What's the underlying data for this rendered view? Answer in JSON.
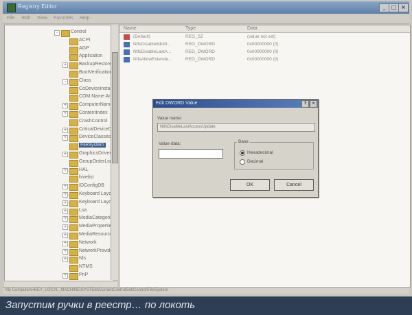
{
  "window": {
    "title": "Registry Editor",
    "controls": [
      "_",
      "□",
      "×"
    ]
  },
  "menubar": [
    "File",
    "Edit",
    "View",
    "Favorites",
    "Help"
  ],
  "tree": {
    "items": [
      {
        "label": "Control",
        "indent": 0,
        "expander": "-"
      },
      {
        "label": "ACPI",
        "indent": 1,
        "expander": ""
      },
      {
        "label": "AGP",
        "indent": 1,
        "expander": ""
      },
      {
        "label": "Application",
        "indent": 1,
        "expander": ""
      },
      {
        "label": "BackupRestore",
        "indent": 1,
        "expander": "+"
      },
      {
        "label": "BootVerification",
        "indent": 1,
        "expander": ""
      },
      {
        "label": "Class",
        "indent": 1,
        "expander": "-"
      },
      {
        "label": "CoDeviceInstallers",
        "indent": 1,
        "expander": ""
      },
      {
        "label": "COM Name Arbiter",
        "indent": 1,
        "expander": ""
      },
      {
        "label": "ComputerName",
        "indent": 1,
        "expander": "+"
      },
      {
        "label": "ContentIndex",
        "indent": 1,
        "expander": "+"
      },
      {
        "label": "CrashControl",
        "indent": 1,
        "expander": ""
      },
      {
        "label": "CriticalDeviceDatabase",
        "indent": 1,
        "expander": "+"
      },
      {
        "label": "DeviceClasses",
        "indent": 1,
        "expander": "+"
      },
      {
        "label": "FileSystem",
        "indent": 1,
        "expander": "",
        "selected": true
      },
      {
        "label": "GraphicsDrivers",
        "indent": 1,
        "expander": "+"
      },
      {
        "label": "GroupOrderList",
        "indent": 1,
        "expander": ""
      },
      {
        "label": "HAL",
        "indent": 1,
        "expander": "+"
      },
      {
        "label": "hivelist",
        "indent": 1,
        "expander": ""
      },
      {
        "label": "IDConfigDB",
        "indent": 1,
        "expander": "+"
      },
      {
        "label": "Keyboard Layout",
        "indent": 1,
        "expander": "+"
      },
      {
        "label": "Keyboard Layouts",
        "indent": 1,
        "expander": "+"
      },
      {
        "label": "Lsa",
        "indent": 1,
        "expander": "+"
      },
      {
        "label": "MediaCategories",
        "indent": 1,
        "expander": "+"
      },
      {
        "label": "MediaProperties",
        "indent": 1,
        "expander": "+"
      },
      {
        "label": "MediaResources",
        "indent": 1,
        "expander": "+"
      },
      {
        "label": "Network",
        "indent": 1,
        "expander": "+"
      },
      {
        "label": "NetworkProvider",
        "indent": 1,
        "expander": "+"
      },
      {
        "label": "Nls",
        "indent": 1,
        "expander": "+"
      },
      {
        "label": "NTMS",
        "indent": 1,
        "expander": ""
      },
      {
        "label": "PnP",
        "indent": 1,
        "expander": "+"
      }
    ]
  },
  "list": {
    "columns": [
      "Name",
      "Type",
      "Data"
    ],
    "rows": [
      {
        "name": "(Default)",
        "type": "REG_SZ",
        "data": "(value not set)",
        "icon": "string-value-icon",
        "color": "#c0504d"
      },
      {
        "name": "NtfsDisable8dot3...",
        "type": "REG_DWORD",
        "data": "0x00000000 (0)",
        "icon": "dword-value-icon",
        "color": "#4a6fb0"
      },
      {
        "name": "NtfsDisableLastA...",
        "type": "REG_DWORD",
        "data": "0x00000000 (0)",
        "icon": "dword-value-icon",
        "color": "#4a6fb0"
      },
      {
        "name": "NtfsAllowExtende...",
        "type": "REG_DWORD",
        "data": "0x00000000 (0)",
        "icon": "dword-value-icon",
        "color": "#4a6fb0"
      }
    ]
  },
  "status": "My Computer\\HKEY_LOCAL_MACHINE\\SYSTEM\\CurrentControlSet\\Control\\FileSystem",
  "dialog": {
    "title": "Edit DWORD Value",
    "value_name_label": "Value name:",
    "value_name": "NtfsDisableLastAccessUpdate",
    "value_data_label": "Value data:",
    "base_label": "Base",
    "hex_label": "Hexadecimal",
    "dec_label": "Decimal",
    "ok_label": "OK",
    "cancel_label": "Cancel"
  },
  "caption": "Запустим ручки в реестр… по локоть",
  "colors": {
    "caption_bg": "#2e3f55",
    "title_blue": "#2d4d8a"
  }
}
